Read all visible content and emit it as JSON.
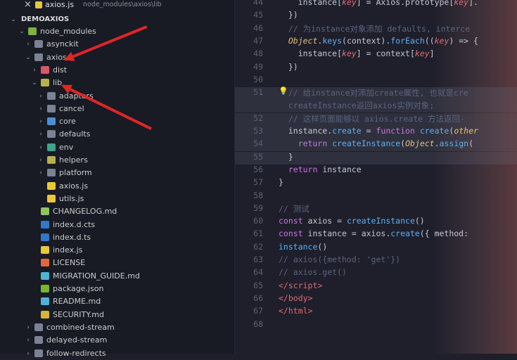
{
  "tab": {
    "close": "×",
    "file": "axios.js",
    "path": "node_modules\\axios\\lib"
  },
  "explorer": {
    "root": "DEMOAXIOS",
    "items": [
      {
        "label": "node_modules",
        "chev": "⌄",
        "icon": "folder-green",
        "indent": 0
      },
      {
        "label": "asynckit",
        "chev": "›",
        "icon": "folder",
        "indent": 1
      },
      {
        "label": "axios",
        "chev": "⌄",
        "icon": "folder",
        "indent": 1
      },
      {
        "label": "dist",
        "chev": "›",
        "icon": "folder-red",
        "indent": 2
      },
      {
        "label": "lib",
        "chev": "⌄",
        "icon": "folder-yellow",
        "indent": 2
      },
      {
        "label": "adapters",
        "chev": "›",
        "icon": "folder",
        "indent": 3
      },
      {
        "label": "cancel",
        "chev": "›",
        "icon": "folder",
        "indent": 3
      },
      {
        "label": "core",
        "chev": "›",
        "icon": "folder-blue",
        "indent": 3
      },
      {
        "label": "defaults",
        "chev": "›",
        "icon": "folder",
        "indent": 3
      },
      {
        "label": "env",
        "chev": "›",
        "icon": "folder-teal",
        "indent": 3
      },
      {
        "label": "helpers",
        "chev": "›",
        "icon": "folder-yellow",
        "indent": 3
      },
      {
        "label": "platform",
        "chev": "›",
        "icon": "folder",
        "indent": 3
      },
      {
        "label": "axios.js",
        "chev": "",
        "icon": "file-js",
        "indent": 3
      },
      {
        "label": "utils.js",
        "chev": "",
        "icon": "file-js",
        "indent": 3
      },
      {
        "label": "CHANGELOG.md",
        "chev": "",
        "icon": "file-change",
        "indent": 2
      },
      {
        "label": "index.d.cts",
        "chev": "",
        "icon": "file-ts",
        "indent": 2
      },
      {
        "label": "index.d.ts",
        "chev": "",
        "icon": "file-ts",
        "indent": 2
      },
      {
        "label": "index.js",
        "chev": "",
        "icon": "file-js",
        "indent": 2
      },
      {
        "label": "LICENSE",
        "chev": "",
        "icon": "file-lic",
        "indent": 2
      },
      {
        "label": "MIGRATION_GUIDE.md",
        "chev": "",
        "icon": "file-md",
        "indent": 2
      },
      {
        "label": "package.json",
        "chev": "",
        "icon": "file-json",
        "indent": 2
      },
      {
        "label": "README.md",
        "chev": "",
        "icon": "file-md",
        "indent": 2
      },
      {
        "label": "SECURITY.md",
        "chev": "",
        "icon": "file-lock",
        "indent": 2
      },
      {
        "label": "combined-stream",
        "chev": "›",
        "icon": "folder",
        "indent": 1
      },
      {
        "label": "delayed-stream",
        "chev": "›",
        "icon": "folder",
        "indent": 1
      },
      {
        "label": "follow-redirects",
        "chev": "›",
        "icon": "folder",
        "indent": 1
      }
    ]
  },
  "editor": {
    "lines": [
      {
        "n": "44",
        "html": "    instance[<i class='pr'>key</i>] = Axios.prototype[<i class='pr'>key</i>].",
        "hl": false
      },
      {
        "n": "45",
        "html": "  })",
        "hl": false
      },
      {
        "n": "46",
        "html": "  <span class='cm'>// 为instance对象添加 defaults, interce</span>",
        "hl": false
      },
      {
        "n": "47",
        "html": "  <span class='obj'>Object</span>.<span class='fn'>keys</span>(context).<span class='fn'>forEach</span>((<i class='pr'>key</i>) => {",
        "hl": false
      },
      {
        "n": "48",
        "html": "    instance[<i class='pr'>key</i>] = context[<i class='pr'>key</i>]",
        "hl": false
      },
      {
        "n": "49",
        "html": "  })",
        "hl": false
      },
      {
        "n": "50",
        "html": "",
        "hl": false
      },
      {
        "n": "51",
        "html": "  <span class='cm'>// 给instance对添加create属性, 也就是cre</span>",
        "hl": true
      },
      {
        "n": "",
        "html": "  <span class='cm'>createInstance返回axios实例对象;</span>",
        "hl": true
      },
      {
        "n": "52",
        "html": "  <span class='cm'>// 这样页面能够以 axios.create 方法返回-</span>",
        "hl": true
      },
      {
        "n": "53",
        "html": "  instance.<span class='fn'>create</span> = <span class='kw'>function</span> <span class='fn'>create</span>(<i class='obj'>other</i>",
        "hl": true
      },
      {
        "n": "54",
        "html": "    <span class='kw'>return</span> <span class='fn'>createInstance</span>(<span class='obj'>Object</span>.<span class='fn'>assign</span>(",
        "hl": true
      },
      {
        "n": "55",
        "html": "  }",
        "hl": true
      },
      {
        "n": "56",
        "html": "  <span class='kw'>return</span> instance",
        "hl": false
      },
      {
        "n": "57",
        "html": "}",
        "hl": false
      },
      {
        "n": "58",
        "html": "",
        "hl": false
      },
      {
        "n": "59",
        "html": "<span class='cm'>// 测试</span>",
        "hl": false
      },
      {
        "n": "60",
        "html": "<span class='kw'>const</span> axios = <span class='fn'>createInstance</span>()",
        "hl": false
      },
      {
        "n": "61",
        "html": "<span class='kw'>const</span> instance = axios.<span class='fn'>create</span>({ method:",
        "hl": false
      },
      {
        "n": "62",
        "html": "<span class='fn'>instance</span>()",
        "hl": false
      },
      {
        "n": "63",
        "html": "<span class='cm'>// axios({method: 'get'})</span>",
        "hl": false
      },
      {
        "n": "64",
        "html": "<span class='cm'>// axios.get()</span>",
        "hl": false
      },
      {
        "n": "65",
        "html": "<span class='tag'>&lt;/script&gt;</span>",
        "hl": false
      },
      {
        "n": "66",
        "html": "<span class='tag'>&lt;/body&gt;</span>",
        "hl": false
      },
      {
        "n": "67",
        "html": "<span class='tag'>&lt;/html&gt;</span>",
        "hl": false
      },
      {
        "n": "68",
        "html": "",
        "hl": false
      }
    ]
  }
}
